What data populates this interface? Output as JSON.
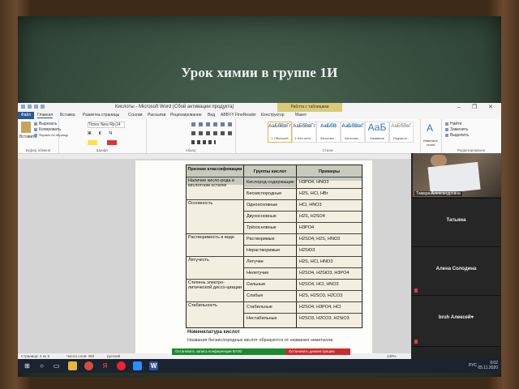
{
  "slide": {
    "title": "Урок химии в группе 1И"
  },
  "window": {
    "title": "Кислоты  -  Microsoft Word (Сбой активации продукта)",
    "context_tab": "Работа с таблицами",
    "controls": "– ❐ ✕"
  },
  "tabs": [
    "Файл",
    "Главная",
    "Вставка",
    "Разметка страницы",
    "Ссылки",
    "Рассылки",
    "Рецензирование",
    "Вид",
    "ABBYY FineReader",
    "Конструктор",
    "Макет"
  ],
  "ribbon": {
    "clipboard": {
      "paste": "Вставить",
      "cut": "Вырезать",
      "copy": "Копировать",
      "format": "Формат по образцу",
      "label": "Буфер обмена"
    },
    "font": {
      "name": "Times New Ro",
      "size": "14",
      "label": "Шрифт"
    },
    "paragraph": {
      "label": "Абзац"
    },
    "styles": {
      "label": "Стили",
      "items": [
        {
          "preview": "АаБбВвГг",
          "name": "1 Обычный"
        },
        {
          "preview": "АаБбВвГг",
          "name": "1 Без инте..."
        },
        {
          "preview": "АаБбВ",
          "name": "Заголово..."
        },
        {
          "preview": "АаБбВвГ",
          "name": "Заголово..."
        },
        {
          "preview": "АаБ",
          "name": "Название"
        },
        {
          "preview": "АаБбВвГ",
          "name": "Подзагол..."
        }
      ],
      "change": "Изменить стили"
    },
    "editing": {
      "find": "Найти",
      "replace": "Заменить",
      "select": "Выделить",
      "label": "Редактирование"
    }
  },
  "table": {
    "headers": [
      "Признак классификации",
      "Группы кислот",
      "Примеры"
    ],
    "rows": [
      {
        "feature": "Наличие кисло-рода в кислотном остатке",
        "group": "Кислород-содержащие",
        "example": "H3PO4, HNO3"
      },
      {
        "feature": "",
        "group": "Бескислородные",
        "example": "H2S, HCl, HBr"
      },
      {
        "feature": "Основность",
        "group": "Одноосновные",
        "example": "HCl, HNO3"
      },
      {
        "feature": "",
        "group": "Двухосновные",
        "example": "H2S, H2SO4"
      },
      {
        "feature": "",
        "group": "Трёхосновные",
        "example": "H3PO4"
      },
      {
        "feature": "Растворимость в воде",
        "group": "Растворимые",
        "example": "H2SO4, H2S, HNO3"
      },
      {
        "feature": "",
        "group": "Нерастворимые",
        "example": "H2SiO3"
      },
      {
        "feature": "Летучесть",
        "group": "Летучие",
        "example": "H2S, HCl, HNO3"
      },
      {
        "feature": "",
        "group": "Нелетучие",
        "example": "H2SO4, H2SiO3, H3PO4"
      },
      {
        "feature": "Степень электро-литической диссо-циации",
        "group": "Сильные",
        "example": "H2SO4, HCl, HNO3"
      },
      {
        "feature": "",
        "group": "Слабые",
        "example": "H2S, H2SO3, H2CO3"
      },
      {
        "feature": "Стабильность",
        "group": "Стабильные",
        "example": "H2SO4, H3PO4, HCl"
      },
      {
        "feature": "",
        "group": "Нестабильные",
        "example": "H2SO3, H2CO3, H2SiO3"
      }
    ]
  },
  "document": {
    "heading": "Номенклатура кислот",
    "line": "Названия бескислородных кислот образуются от названия неметалла"
  },
  "statusbar": {
    "page": "Страница: 2 из 5",
    "words": "Число слов: 459",
    "lang": "русский",
    "zoom": "130%"
  },
  "meeting": {
    "participants": [
      {
        "name": "Тамара Александровна",
        "video": true
      },
      {
        "name": "Татьяна",
        "video": false
      },
      {
        "name": "Алена Солодина",
        "video": false
      },
      {
        "name": "bruh Алексей♥",
        "video": false
      }
    ],
    "notify_share": "Остановить запись конференции 00:00",
    "notify_stop": "Остановить демонстрацию"
  },
  "taskbar": {
    "icons": [
      "start-icon",
      "search-icon",
      "task-view-icon",
      "explorer-icon",
      "chrome-icon",
      "yandex-browser-icon",
      "opera-icon",
      "zoom-icon",
      "word-icon"
    ],
    "lang": "РУС",
    "time": "9:02",
    "date": "05.11.2020"
  }
}
